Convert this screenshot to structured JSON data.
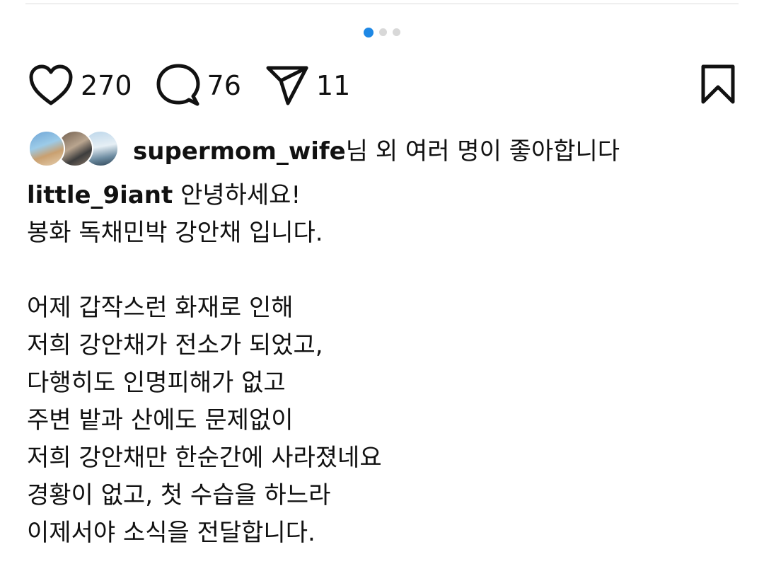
{
  "carousel": {
    "dots": 3,
    "active_index": 0,
    "active_color": "#1e88e5"
  },
  "actions": {
    "like_icon": "heart-icon",
    "like_count": "270",
    "comment_icon": "comment-bubble-icon",
    "comment_count": "76",
    "share_icon": "send-paper-plane-icon",
    "share_count": "11",
    "bookmark_icon": "bookmark-icon"
  },
  "likes": {
    "user": "supermom_wife",
    "suffix": "님 외 여러 명이 좋아합니다"
  },
  "caption": {
    "author": "little_9iant",
    "first_line": "안녕하세요!",
    "lines": [
      "봉화 독채민박 강안채 입니다.",
      "",
      "어제 갑작스런 화재로 인해",
      "저희 강안채가 전소가 되었고,",
      "다행히도 인명피해가 없고",
      "주변 밭과 산에도 문제없이",
      "저희 강안채만 한순간에 사라졌네요",
      "경황이 없고, 첫 수습을 하느라",
      "이제서야 소식을 전달합니다."
    ]
  }
}
